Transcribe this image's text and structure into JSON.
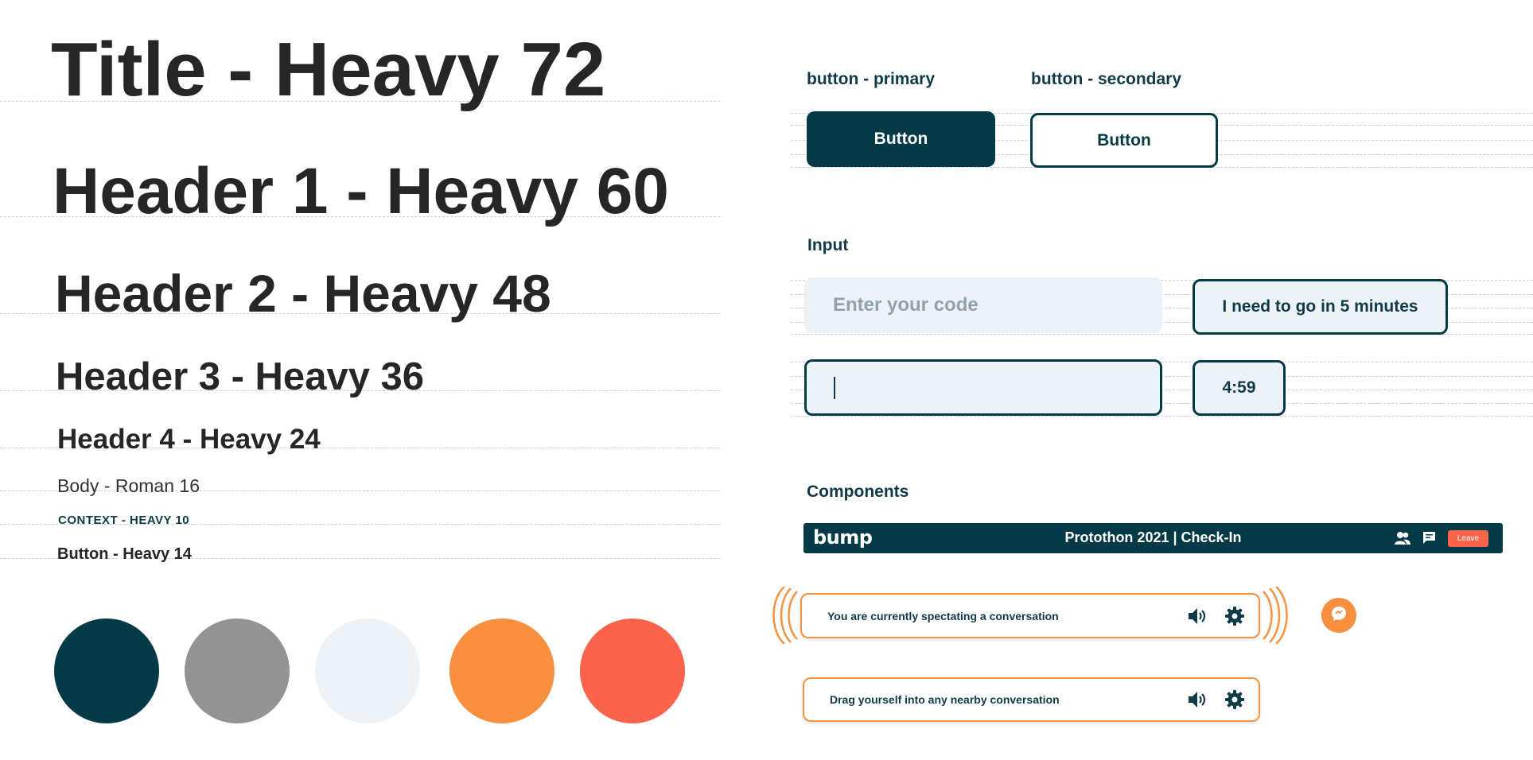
{
  "typography": {
    "title": "Title - Heavy 72",
    "header1": "Header 1 - Heavy 60",
    "header2": "Header 2 - Heavy 48",
    "header3": "Header 3 - Heavy 36",
    "header4": "Header 4 - Heavy 24",
    "body": "Body - Roman 16",
    "context": "CONTEXT - HEAVY 10",
    "button": "Button - Heavy 14"
  },
  "colors": [
    "#033a46",
    "#939393",
    "#edf2f6",
    "#f78f3e",
    "#fc634b"
  ],
  "buttons": {
    "primary_label": "button - primary",
    "secondary_label": "button - secondary",
    "primary_text": "Button",
    "secondary_text": "Button"
  },
  "inputs": {
    "section_label": "Input",
    "code_placeholder": "Enter your code",
    "leave_message": "I need to go in 5 minutes",
    "active_value": "",
    "timer": "4:59"
  },
  "components": {
    "section_label": "Components",
    "navbar": {
      "logo": "bump",
      "title": "Protothon 2021 | Check-In",
      "icons": [
        "people-icon",
        "chat-icon"
      ],
      "leave_label": "Leave"
    },
    "spectating_text": "You are currently spectating a conversation",
    "drag_text": "Drag yourself into any nearby conversation",
    "pill_icons": [
      "speaker-icon",
      "gear-icon"
    ],
    "floating_icon": "chat-bubble-icon"
  }
}
